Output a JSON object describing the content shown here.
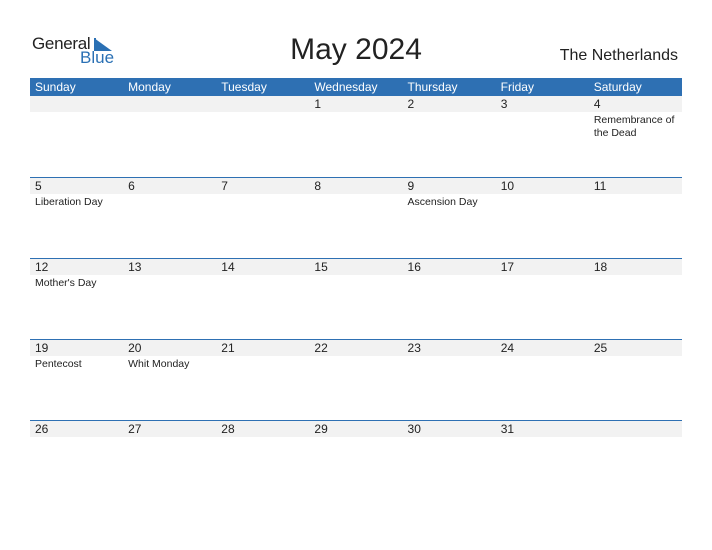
{
  "logo": {
    "general": "General",
    "blue": "Blue"
  },
  "title": "May 2024",
  "country": "The Netherlands",
  "colors": {
    "accent": "#2e70b3",
    "strip": "#f2f2f2"
  },
  "weekdays": [
    "Sunday",
    "Monday",
    "Tuesday",
    "Wednesday",
    "Thursday",
    "Friday",
    "Saturday"
  ],
  "weeks": [
    [
      {
        "d": ""
      },
      {
        "d": ""
      },
      {
        "d": ""
      },
      {
        "d": "1"
      },
      {
        "d": "2"
      },
      {
        "d": "3"
      },
      {
        "d": "4",
        "e": "Remembrance of the Dead"
      }
    ],
    [
      {
        "d": "5",
        "e": "Liberation Day"
      },
      {
        "d": "6"
      },
      {
        "d": "7"
      },
      {
        "d": "8"
      },
      {
        "d": "9",
        "e": "Ascension Day"
      },
      {
        "d": "10"
      },
      {
        "d": "11"
      }
    ],
    [
      {
        "d": "12",
        "e": "Mother's Day"
      },
      {
        "d": "13"
      },
      {
        "d": "14"
      },
      {
        "d": "15"
      },
      {
        "d": "16"
      },
      {
        "d": "17"
      },
      {
        "d": "18"
      }
    ],
    [
      {
        "d": "19",
        "e": "Pentecost"
      },
      {
        "d": "20",
        "e": "Whit Monday"
      },
      {
        "d": "21"
      },
      {
        "d": "22"
      },
      {
        "d": "23"
      },
      {
        "d": "24"
      },
      {
        "d": "25"
      }
    ],
    [
      {
        "d": "26"
      },
      {
        "d": "27"
      },
      {
        "d": "28"
      },
      {
        "d": "29"
      },
      {
        "d": "30"
      },
      {
        "d": "31"
      },
      {
        "d": ""
      }
    ]
  ]
}
